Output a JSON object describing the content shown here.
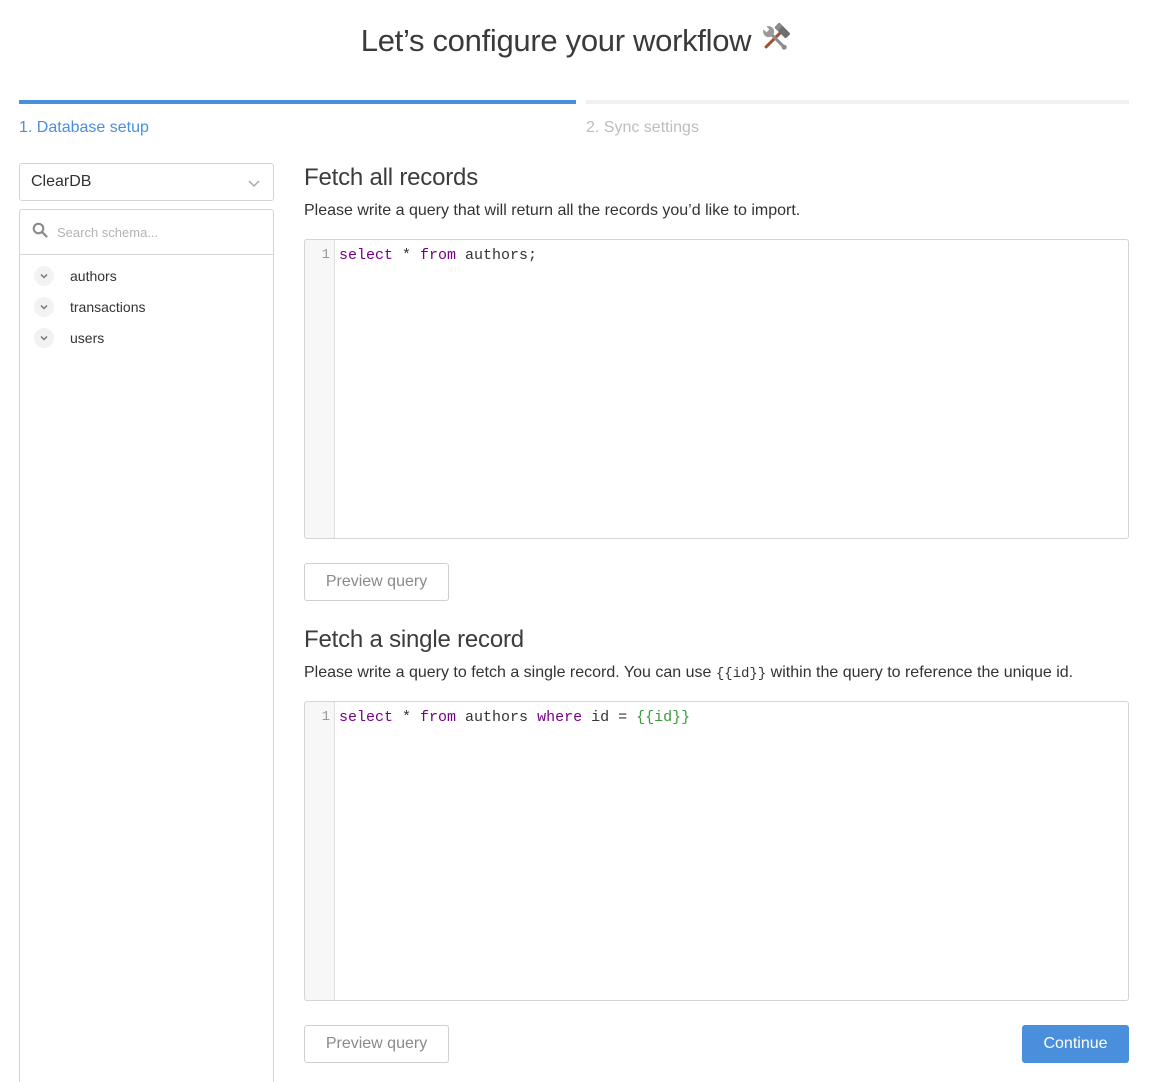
{
  "page": {
    "title": "Let’s configure your workflow"
  },
  "steps": [
    {
      "label": "1. Database setup",
      "active": true
    },
    {
      "label": "2. Sync settings",
      "active": false
    }
  ],
  "sidebar": {
    "database": "ClearDB",
    "search_placeholder": "Search schema...",
    "tables": [
      "authors",
      "transactions",
      "users"
    ]
  },
  "fetch_all": {
    "title": "Fetch all records",
    "description": "Please write a query that will return all the records you’d like to import.",
    "line_number": "1",
    "query": [
      {
        "t": "select",
        "k": "kw"
      },
      {
        "t": " * ",
        "k": ""
      },
      {
        "t": "from",
        "k": "kw"
      },
      {
        "t": " authors;",
        "k": ""
      }
    ],
    "preview_label": "Preview query"
  },
  "fetch_single": {
    "title": "Fetch a single record",
    "description_before": "Please write a query to fetch a single record. You can use ",
    "description_code": "{{id}}",
    "description_after": " within the query to reference the unique id.",
    "line_number": "1",
    "query": [
      {
        "t": "select",
        "k": "kw"
      },
      {
        "t": " * ",
        "k": ""
      },
      {
        "t": "from",
        "k": "kw"
      },
      {
        "t": " authors ",
        "k": ""
      },
      {
        "t": "where",
        "k": "kw"
      },
      {
        "t": " id = ",
        "k": ""
      },
      {
        "t": "{{id}}",
        "k": "tpl"
      }
    ],
    "preview_label": "Preview query"
  },
  "continue_label": "Continue",
  "colors": {
    "accent": "#4a8fdc",
    "keyword": "#770088",
    "template": "#3a9a3a"
  },
  "icons": {
    "title": "hammer-and-wrench-icon",
    "select": "chevron-down-icon",
    "search": "search-icon",
    "tree_toggle": "chevron-down-icon"
  }
}
